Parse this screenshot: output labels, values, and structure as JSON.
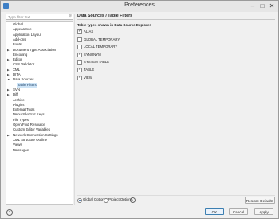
{
  "window": {
    "title": "Preferences",
    "min_icon": "minimize-icon",
    "max_icon": "maximize-icon",
    "close_icon": "close-icon"
  },
  "filter": {
    "placeholder": "Type filter text"
  },
  "tree": [
    {
      "label": "Global",
      "arrow": false,
      "child": false
    },
    {
      "label": "Appearance",
      "arrow": false,
      "child": false
    },
    {
      "label": "Application Layout",
      "arrow": false,
      "child": false
    },
    {
      "label": "Add-ons",
      "arrow": false,
      "child": false
    },
    {
      "label": "Fonts",
      "arrow": false,
      "child": false
    },
    {
      "label": "Document Type Association",
      "arrow": true,
      "child": false
    },
    {
      "label": "Encoding",
      "arrow": false,
      "child": false
    },
    {
      "label": "Editor",
      "arrow": true,
      "child": false
    },
    {
      "label": "CSS Validator",
      "arrow": false,
      "child": false
    },
    {
      "label": "XML",
      "arrow": true,
      "child": false
    },
    {
      "label": "DITA",
      "arrow": true,
      "child": false
    },
    {
      "label": "Data Sources",
      "arrow": true,
      "expanded": true,
      "child": false
    },
    {
      "label": "Table Filters",
      "arrow": false,
      "child": true,
      "selected": true
    },
    {
      "label": "SVN",
      "arrow": true,
      "child": false
    },
    {
      "label": "Diff",
      "arrow": true,
      "child": false
    },
    {
      "label": "Archive",
      "arrow": false,
      "child": false
    },
    {
      "label": "Plugins",
      "arrow": false,
      "child": false
    },
    {
      "label": "External Tools",
      "arrow": false,
      "child": false
    },
    {
      "label": "Menu Shortcut Keys",
      "arrow": false,
      "child": false
    },
    {
      "label": "File Types",
      "arrow": false,
      "child": false
    },
    {
      "label": "Open/Find Resource",
      "arrow": false,
      "child": false
    },
    {
      "label": "Custom Editor Variables",
      "arrow": false,
      "child": false
    },
    {
      "label": "Network Connection Settings",
      "arrow": true,
      "child": false
    },
    {
      "label": "XML Structure Outline",
      "arrow": false,
      "child": false
    },
    {
      "label": "Views",
      "arrow": false,
      "child": false
    },
    {
      "label": "Messages",
      "arrow": false,
      "child": false
    }
  ],
  "page": {
    "title": "Data Sources / Table Filters",
    "group_title": "Table types shown in Data Source Explorer",
    "checkboxes": [
      {
        "label": "ALIAS",
        "checked": true
      },
      {
        "label": "GLOBAL TEMPORARY",
        "checked": false
      },
      {
        "label": "LOCAL TEMPORARY",
        "checked": false
      },
      {
        "label": "SYNONYM",
        "checked": true
      },
      {
        "label": "SYSTEM TABLE",
        "checked": false
      },
      {
        "label": "TABLE",
        "checked": true
      },
      {
        "label": "VIEW",
        "checked": true
      }
    ]
  },
  "footer": {
    "global_options": "Global Options",
    "project_options": "Project Options",
    "restore_defaults": "Restore Defaults",
    "ok": "OK",
    "cancel": "Cancel",
    "apply": "Apply",
    "help_glyph": "?",
    "info_glyph": "i"
  },
  "colors": {
    "selection": "#cde4f7",
    "accent": "#3c7fb1"
  }
}
